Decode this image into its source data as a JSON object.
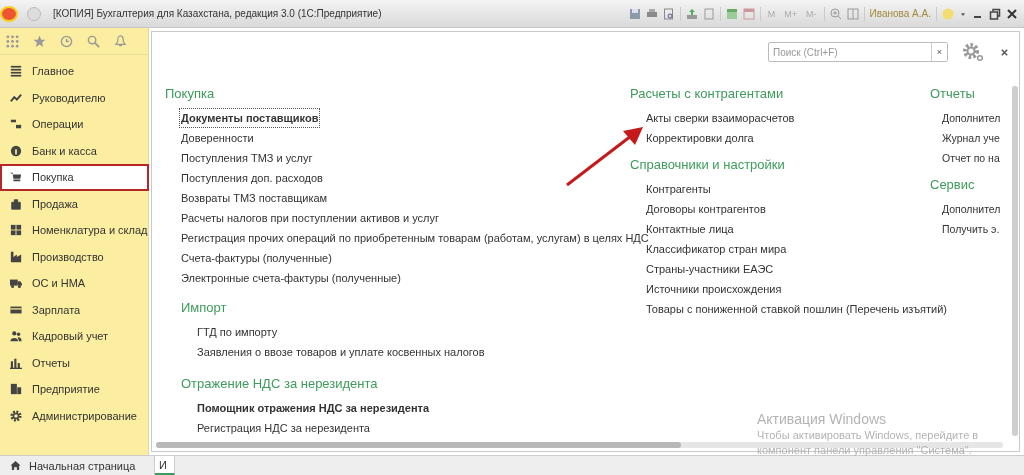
{
  "window": {
    "title": "[КОПИЯ] Бухгалтерия для Казахстана, редакция 3.0  (1С:Предприятие)",
    "memory_buttons": [
      "M",
      "M+",
      "M-"
    ],
    "user": "Иванова А.А."
  },
  "sidebar": {
    "items": [
      {
        "label": "Главное",
        "selected": false
      },
      {
        "label": "Руководителю",
        "selected": false
      },
      {
        "label": "Операции",
        "selected": false
      },
      {
        "label": "Банк и касса",
        "selected": false
      },
      {
        "label": "Покупка",
        "selected": true
      },
      {
        "label": "Продажа",
        "selected": false
      },
      {
        "label": "Номенклатура и склад",
        "selected": false
      },
      {
        "label": "Производство",
        "selected": false
      },
      {
        "label": "ОС и НМА",
        "selected": false
      },
      {
        "label": "Зарплата",
        "selected": false
      },
      {
        "label": "Кадровый учет",
        "selected": false
      },
      {
        "label": "Отчеты",
        "selected": false
      },
      {
        "label": "Предприятие",
        "selected": false
      },
      {
        "label": "Администрирование",
        "selected": false
      }
    ]
  },
  "search": {
    "placeholder": "Поиск (Ctrl+F)",
    "clear": "×"
  },
  "columns": [
    {
      "sections": [
        {
          "title": "Покупка",
          "items": [
            {
              "label": "Документы поставщиков",
              "bold": true,
              "focused": true
            },
            {
              "label": "Доверенности",
              "bold": false,
              "focused": false
            },
            {
              "label": "Поступления ТМЗ и услуг",
              "bold": false,
              "focused": false
            },
            {
              "label": "Поступления доп. расходов",
              "bold": false,
              "focused": false
            },
            {
              "label": "Возвраты ТМЗ поставщикам",
              "bold": false,
              "focused": false
            },
            {
              "label": "Расчеты налогов при поступлении активов и услуг",
              "bold": false,
              "focused": false
            },
            {
              "label": "Регистрация прочих операций по приобретенным товарам (работам, услугам) в целях НДС",
              "bold": false,
              "focused": false
            },
            {
              "label": "Счета-фактуры (полученные)",
              "bold": false,
              "focused": false
            },
            {
              "label": "Электронные счета-фактуры (полученные)",
              "bold": false,
              "focused": false
            }
          ],
          "children": [
            {
              "title": "Импорт",
              "items": [
                {
                  "label": "ГТД по импорту",
                  "bold": false,
                  "focused": false
                },
                {
                  "label": "Заявления о ввозе товаров и уплате косвенных налогов",
                  "bold": false,
                  "focused": false
                }
              ]
            },
            {
              "title": "Отражение НДС за нерезидента",
              "items": [
                {
                  "label": "Помощник отражения НДС за нерезидента",
                  "bold": true,
                  "focused": false
                },
                {
                  "label": "Регистрация НДС за нерезидента",
                  "bold": false,
                  "focused": false
                }
              ]
            }
          ]
        }
      ]
    },
    {
      "sections": [
        {
          "title": "Расчеты с контрагентами",
          "items": [
            {
              "label": "Акты сверки взаиморасчетов",
              "bold": false,
              "focused": false
            },
            {
              "label": "Корректировки долга",
              "bold": false,
              "focused": false
            }
          ]
        },
        {
          "title": "Справочники и настройки",
          "items": [
            {
              "label": "Контрагенты",
              "bold": false,
              "focused": false
            },
            {
              "label": "Договоры контрагентов",
              "bold": false,
              "focused": false
            },
            {
              "label": "Контактные лица",
              "bold": false,
              "focused": false
            },
            {
              "label": "Классификатор стран мира",
              "bold": false,
              "focused": false
            },
            {
              "label": "Страны-участники ЕАЭС",
              "bold": false,
              "focused": false
            },
            {
              "label": "Источники происхождения",
              "bold": false,
              "focused": false
            },
            {
              "label": "Товары с пониженной ставкой пошлин (Перечень изъятий)",
              "bold": false,
              "focused": false
            }
          ]
        }
      ]
    },
    {
      "sections": [
        {
          "title": "Отчеты",
          "items": [
            {
              "label": "Дополнител",
              "bold": false,
              "focused": false
            },
            {
              "label": "Журнал уче",
              "bold": false,
              "focused": false
            },
            {
              "label": "Отчет по на",
              "bold": false,
              "focused": false
            }
          ]
        },
        {
          "title": "Сервис",
          "items": [
            {
              "label": "Дополнител",
              "bold": false,
              "focused": false
            },
            {
              "label": "Получить э.",
              "bold": false,
              "focused": false
            }
          ]
        }
      ]
    }
  ],
  "bottom_tabs": [
    {
      "label": "Начальная страница",
      "kind": "home",
      "selected": false
    },
    {
      "label": "И",
      "kind": "page",
      "selected": true
    }
  ],
  "os_notice": {
    "title": "Активация Windows",
    "text": "Чтобы активировать Windows, перейдите в компонент панели управления \"Система\"."
  }
}
